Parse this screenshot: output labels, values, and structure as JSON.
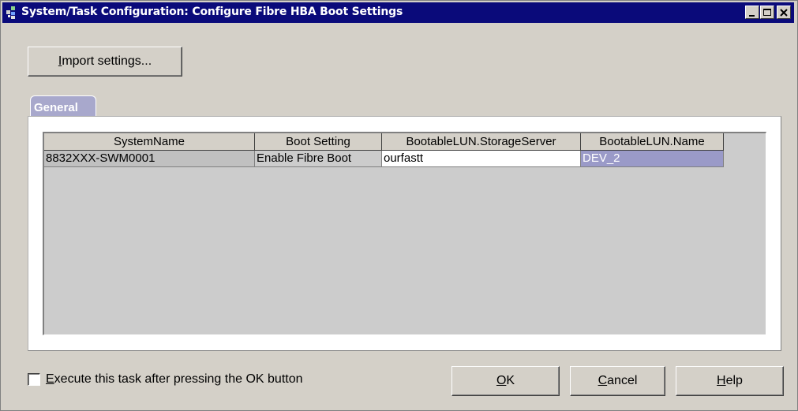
{
  "window": {
    "title": "System/Task Configuration: Configure Fibre HBA Boot Settings",
    "titlebar_color": "#0a0a7a"
  },
  "toolbar": {
    "import_label_accel": "I",
    "import_label_rest": "mport settings..."
  },
  "tabs": [
    {
      "label": "General",
      "selected": true
    }
  ],
  "table": {
    "columns": [
      "SystemName",
      "Boot Setting",
      "BootableLUN.StorageServer",
      "BootableLUN.Name"
    ],
    "rows": [
      [
        "8832XXX-SWM0001",
        "Enable Fibre Boot",
        "ourfastt",
        "DEV_2"
      ]
    ],
    "selected_cell_color": "#9a9ac8"
  },
  "footer": {
    "execute_checked": false,
    "execute_accel": "E",
    "execute_rest": "xecute this task after pressing the OK button",
    "ok_accel": "O",
    "ok_rest": "K",
    "cancel_accel": "C",
    "cancel_rest": "ancel",
    "help_accel": "H",
    "help_rest": "elp"
  }
}
